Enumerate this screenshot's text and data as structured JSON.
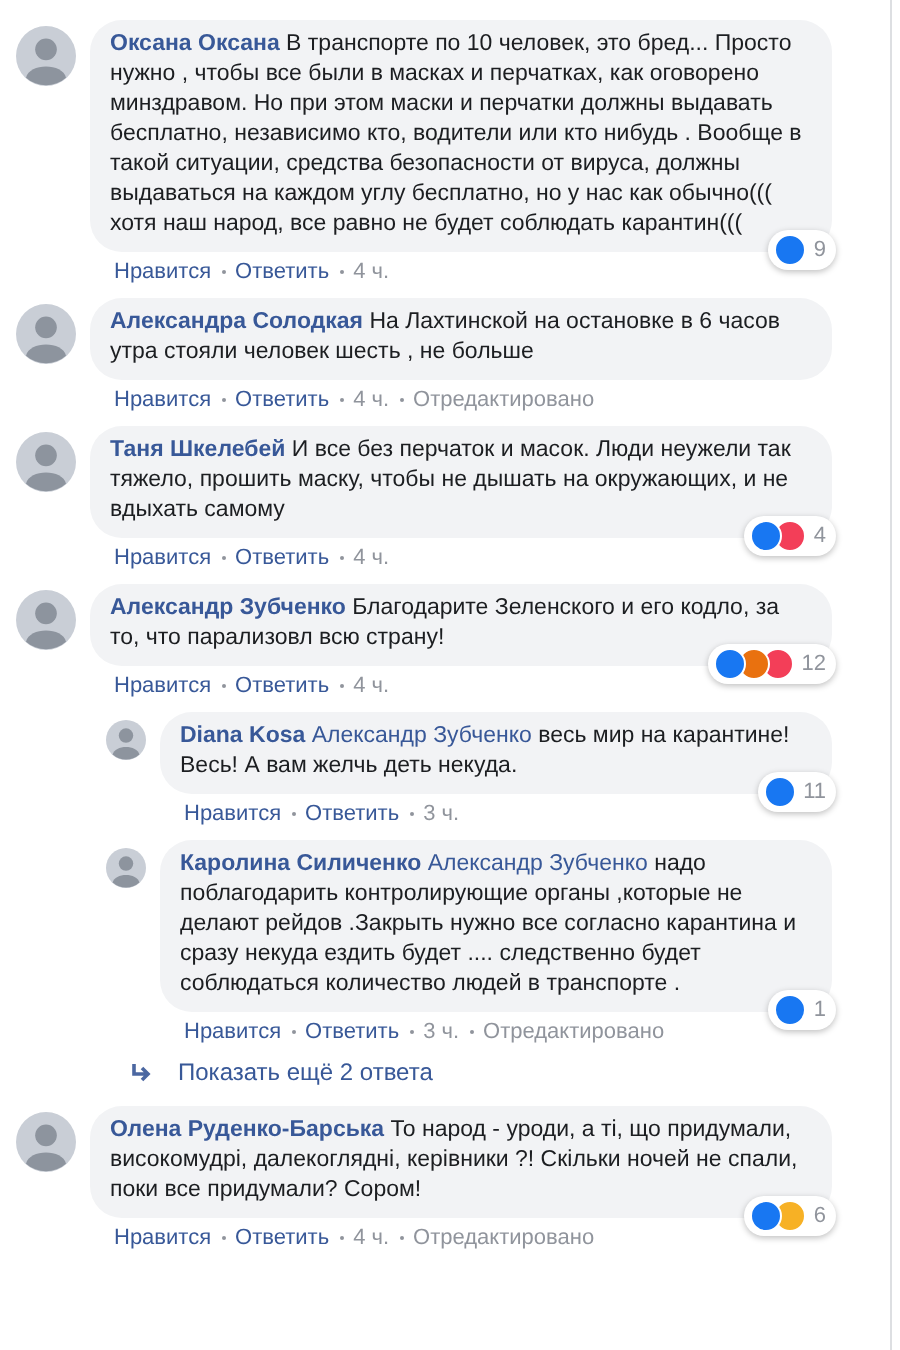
{
  "comments": [
    {
      "author": "Оксана Оксана",
      "text": "В транспорте по 10 человек, это бред... Просто нужно , чтобы все были в масках и перчатках, как оговорено минздравом. Но при этом маски и перчатки должны выдавать бесплатно, независимо кто, водители или кто нибудь . Вообще в такой ситуации, средства безопасности от вируса, должны выдаваться на каждом углу бесплатно, но у нас как обычно((( хотя наш народ, все равно не будет соблюдать карантин(((",
      "reactions": [
        {
          "kind": "like"
        }
      ],
      "reaction_count": "9",
      "like": "Нравится",
      "reply": "Ответить",
      "time": "4 ч."
    },
    {
      "author": "Александра Солодкая",
      "text": "На Лахтинской на остановке в 6 часов утра стояли человек шесть , не больше",
      "like": "Нравится",
      "reply": "Ответить",
      "time": "4 ч.",
      "edited": "Отредактировано"
    },
    {
      "author": "Таня Шкелебей",
      "text": "И все без перчаток и масок. Люди неужели так тяжело, прошить маску, чтобы не дышать на окружающих, и не вдыхать самому",
      "reactions": [
        {
          "kind": "like"
        },
        {
          "kind": "love"
        }
      ],
      "reaction_count": "4",
      "like": "Нравится",
      "reply": "Ответить",
      "time": "4 ч."
    },
    {
      "author": "Александр Зубченко",
      "text": "Благодарите Зеленского и его кодло, за то, что парализовл всю страну!",
      "reactions": [
        {
          "kind": "like"
        },
        {
          "kind": "angry"
        },
        {
          "kind": "love"
        }
      ],
      "reaction_count": "12",
      "like": "Нравится",
      "reply": "Ответить",
      "time": "4 ч.",
      "replies": [
        {
          "author": "Diana Kosa",
          "mention": "Александр Зубченко",
          "text": "весь мир на карантине! Весь! А вам желчь деть некуда.",
          "reactions": [
            {
              "kind": "like"
            }
          ],
          "reaction_count": "11",
          "like": "Нравится",
          "reply": "Ответить",
          "time": "3 ч."
        },
        {
          "author": "Каролина Силиченко",
          "mention": "Александр Зубченко",
          "text": "надо поблагодарить контролирующие органы ,которые не делают рейдов .Закрыть нужно все согласно карантина и сразу некуда ездить будет .... следственно будет соблюдаться количество людей в транспорте .",
          "reactions": [
            {
              "kind": "like"
            }
          ],
          "reaction_count": "1",
          "like": "Нравится",
          "reply": "Ответить",
          "time": "3 ч.",
          "edited": "Отредактировано"
        }
      ],
      "more_replies": "Показать ещё 2 ответа"
    },
    {
      "author": "Олена Руденко-Барська",
      "text": "То народ - уроди, а ті, що придумали, високомудрі, далекоглядні, керівники ?! Скільки ночей не спали, поки все придумали? Сором!",
      "reactions": [
        {
          "kind": "like"
        },
        {
          "kind": "haha"
        }
      ],
      "reaction_count": "6",
      "like": "Нравится",
      "reply": "Ответить",
      "time": "4 ч.",
      "edited": "Отредактировано"
    }
  ]
}
